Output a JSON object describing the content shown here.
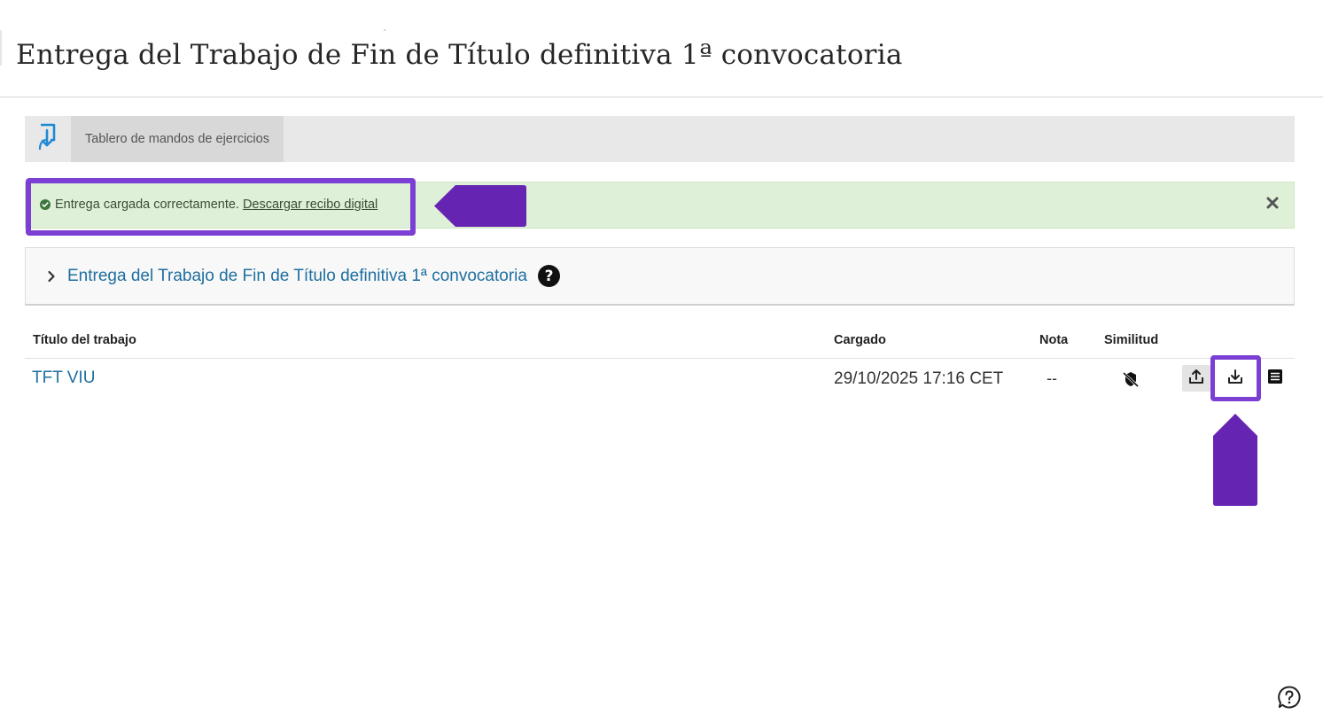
{
  "page": {
    "title": "Entrega del Trabajo de Fin de Título definitiva 1ª convocatoria"
  },
  "toolbar": {
    "icon": "return-arrow-icon",
    "tab_label": "Tablero de mandos de ejercicios"
  },
  "banner": {
    "status": "success",
    "message": "Entrega cargada correctamente.",
    "link_label": "Descargar recibo digital",
    "close_icon": "close-icon"
  },
  "panel": {
    "chevron_icon": "chevron-right-icon",
    "link_label": "Entrega del Trabajo de Fin de Título definitiva 1ª convocatoria",
    "help_label": "?"
  },
  "table": {
    "headers": [
      "Título del trabajo",
      "Cargado",
      "Nota",
      "Similitud"
    ],
    "rows": [
      {
        "title": "TFT VIU",
        "uploaded": "29/10/2025 17:16 CET",
        "grade": "--",
        "similarity_icon": "similarity-disabled-icon",
        "actions": [
          "upload-icon",
          "download-icon",
          "details-icon"
        ]
      }
    ]
  },
  "annotations": {
    "highlight_color": "#7c3fd4",
    "arrow_color": "#6624b3"
  },
  "colors": {
    "banner_bg": "#dff0d8",
    "link": "#1f6fa0",
    "toolbar_bg": "#e8e8e8"
  }
}
